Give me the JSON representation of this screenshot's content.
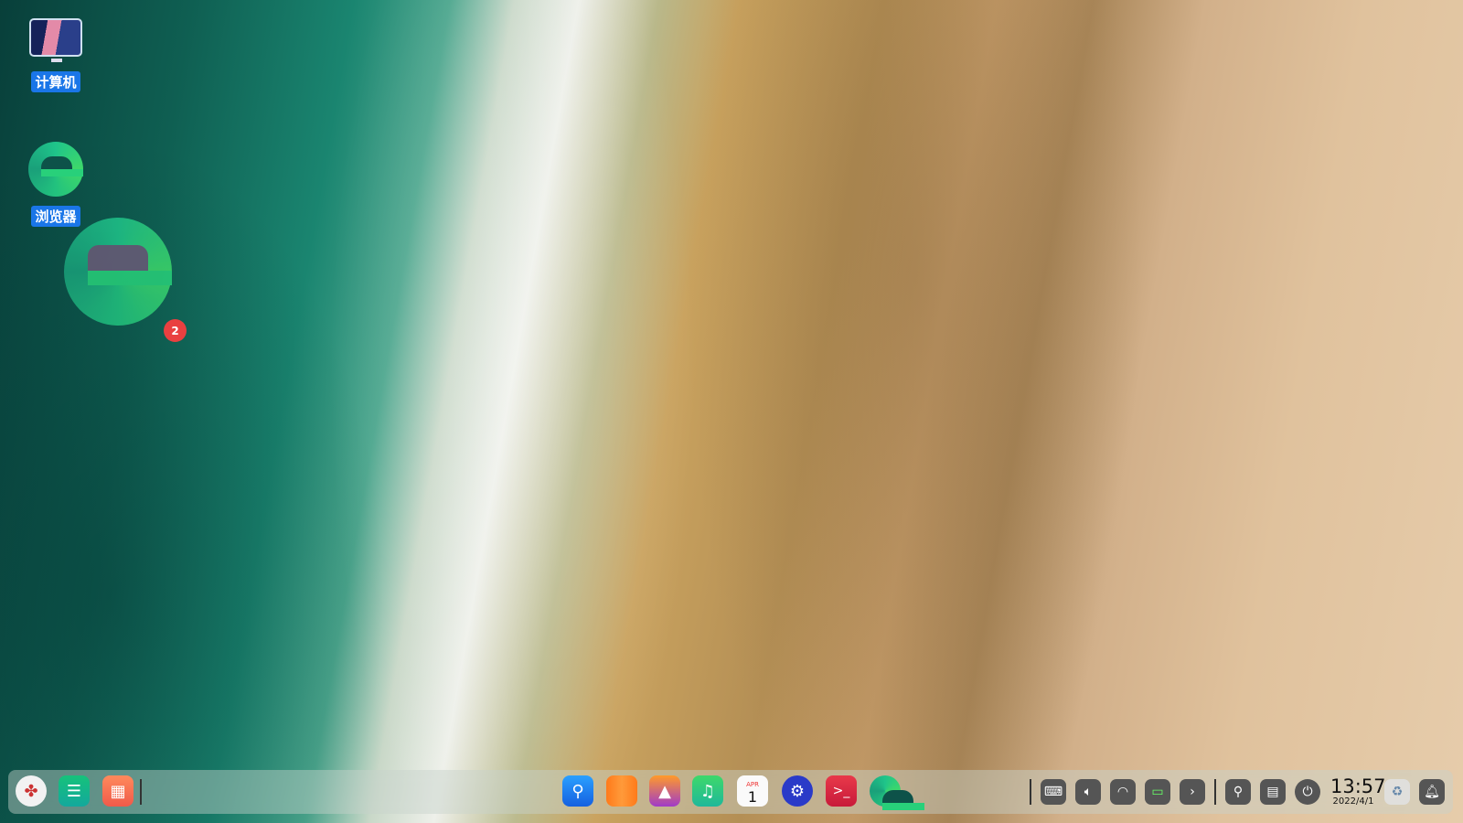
{
  "desktop": {
    "icons": [
      {
        "label": "计算机",
        "icon": "computer-icon"
      },
      {
        "label": "浏览器",
        "icon": "browser-icon"
      }
    ],
    "drag_badge": "2"
  },
  "dock": {
    "left": [
      "launcher-icon",
      "multitask-view-icon",
      "app-grid-icon"
    ],
    "apps": [
      "file-manager-icon",
      "app-store-icon",
      "image-viewer-icon",
      "music-icon",
      "calendar-icon",
      "control-center-icon",
      "terminal-icon",
      "browser-icon"
    ],
    "calendar": {
      "month": "APR",
      "day": "1"
    },
    "terminal_glyph": ">_",
    "tray": [
      "keyboard-icon",
      "volume-icon",
      "wifi-icon",
      "battery-icon",
      "expand-arrow-icon",
      "search-icon",
      "onscreen-keyboard-icon",
      "power-icon"
    ],
    "time": "13:57",
    "date": "2022/4/1"
  }
}
